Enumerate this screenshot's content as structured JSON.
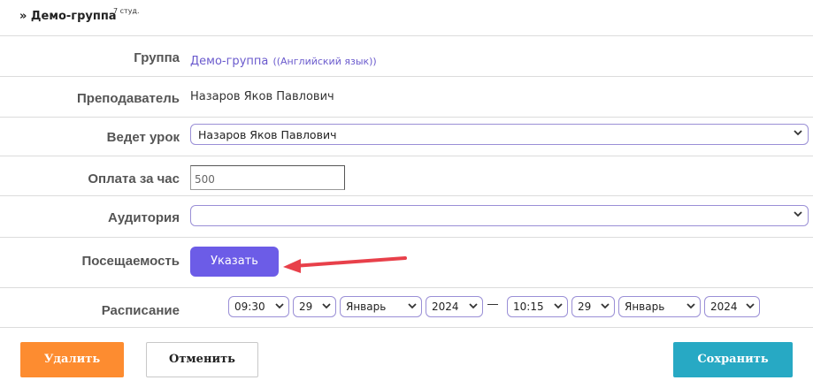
{
  "header": {
    "title": "» Демо-группа",
    "count": "7 студ."
  },
  "rows": {
    "group": {
      "label": "Группа",
      "value": "Демо-группа",
      "sub": "((Английский язык))"
    },
    "teacher": {
      "label": "Преподаватель",
      "value": "Назаров Яков Павлович"
    },
    "lesson_by": {
      "label": "Ведет урок",
      "selected": "Назаров Яков Павлович"
    },
    "rate": {
      "label": "Оплата за час",
      "value": "500"
    },
    "room": {
      "label": "Аудитория",
      "selected": ""
    },
    "attendance": {
      "label": "Посещаемость",
      "button": "Указать"
    },
    "schedule": {
      "label": "Расписание",
      "start": {
        "time": "09:30",
        "day": "29",
        "month": "Январь",
        "year": "2024"
      },
      "end": {
        "time": "10:15",
        "day": "29",
        "month": "Январь",
        "year": "2024"
      }
    }
  },
  "footer": {
    "delete": "Удалить",
    "cancel": "Отменить",
    "save": "Сохранить"
  },
  "colors": {
    "accent": "#6c5ce7",
    "delete": "#fd8c30",
    "save": "#27a9c4",
    "arrow": "#e8404a"
  },
  "icons": {
    "select": "chevron-down-icon",
    "annotation": "red-arrow-icon"
  }
}
